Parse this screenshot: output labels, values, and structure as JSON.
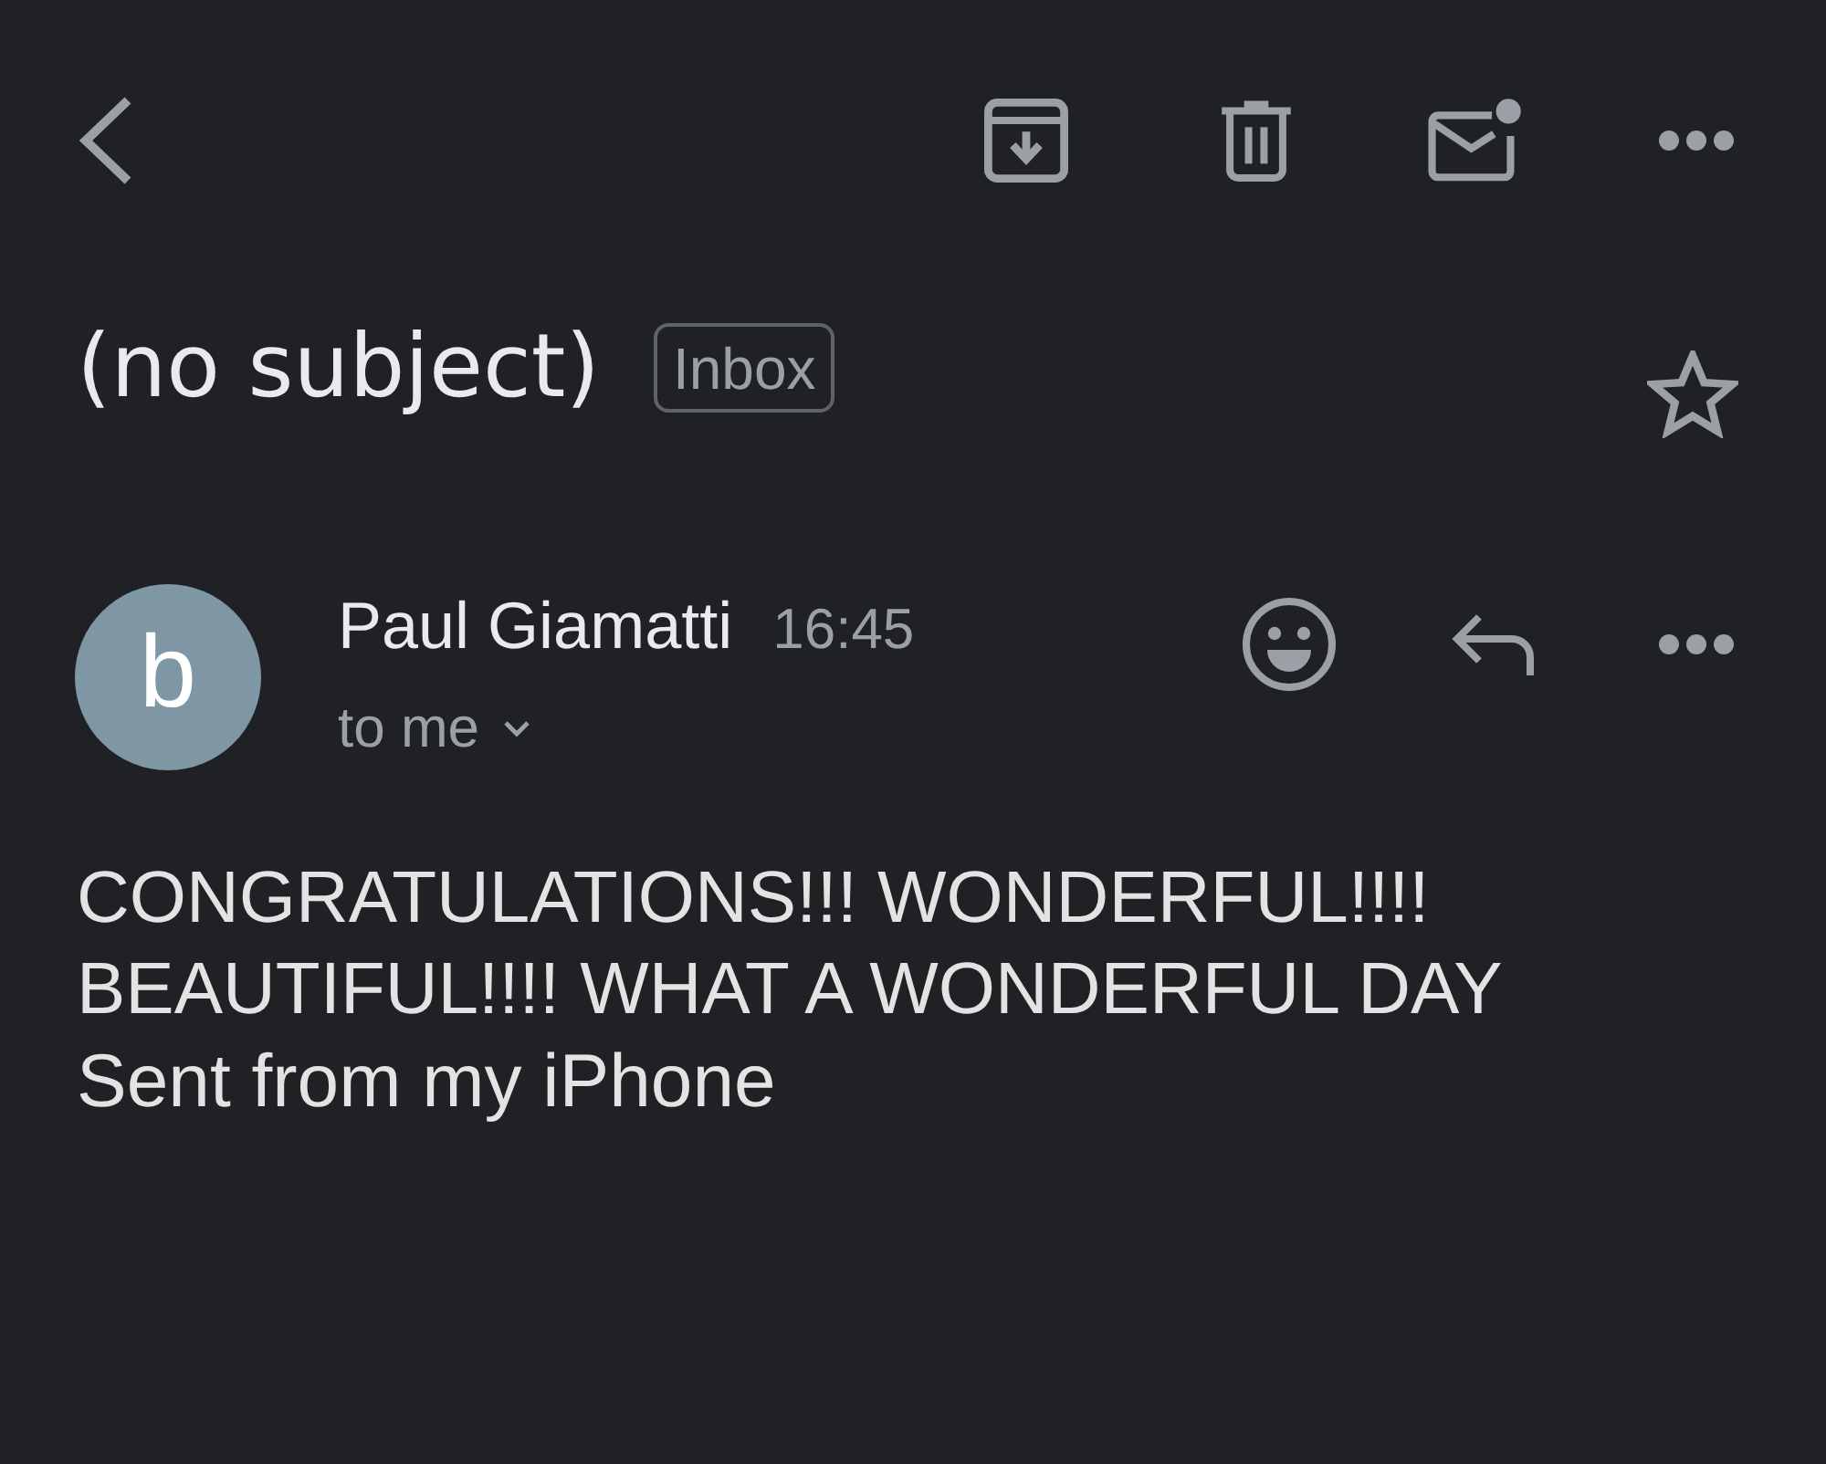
{
  "message": {
    "subject": "(no subject)",
    "label": "Inbox",
    "starred": false
  },
  "sender": {
    "avatar_letter": "b",
    "name": "Paul Giamatti",
    "time": "16:45",
    "recipients": "to me"
  },
  "body": {
    "text": "CONGRATULATIONS!!! WONDERFUL!!!! BEAUTIFUL!!!! WHAT A WONDERFUL DAY",
    "signature": "Sent from my iPhone"
  }
}
